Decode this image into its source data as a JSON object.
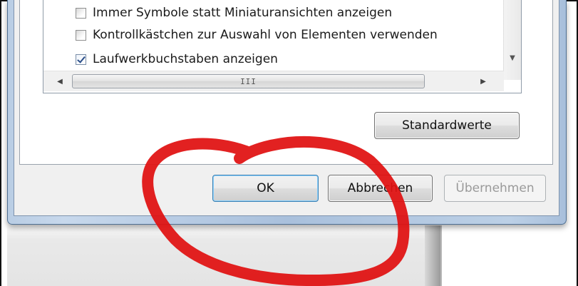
{
  "options_list": {
    "items": [
      {
        "label": "Immer Symbole statt Miniaturansichten anzeigen",
        "checked": false
      },
      {
        "label": "Kontrollkästchen zur Auswahl von Elementen verwenden",
        "checked": false
      },
      {
        "label": "Laufwerkbuchstaben anzeigen",
        "checked": true
      }
    ],
    "scroll_grip": "III"
  },
  "buttons": {
    "defaults_label": "Standardwerte",
    "ok_label": "OK",
    "cancel_label": "Abbrechen",
    "apply_label": "Übernehmen"
  },
  "icons": {
    "scroll_left": "arrow-left-icon",
    "scroll_right": "arrow-right-icon",
    "scroll_down": "arrow-down-icon"
  },
  "colors": {
    "annotation_red": "#e01010",
    "window_frame": "#b9cde4"
  }
}
